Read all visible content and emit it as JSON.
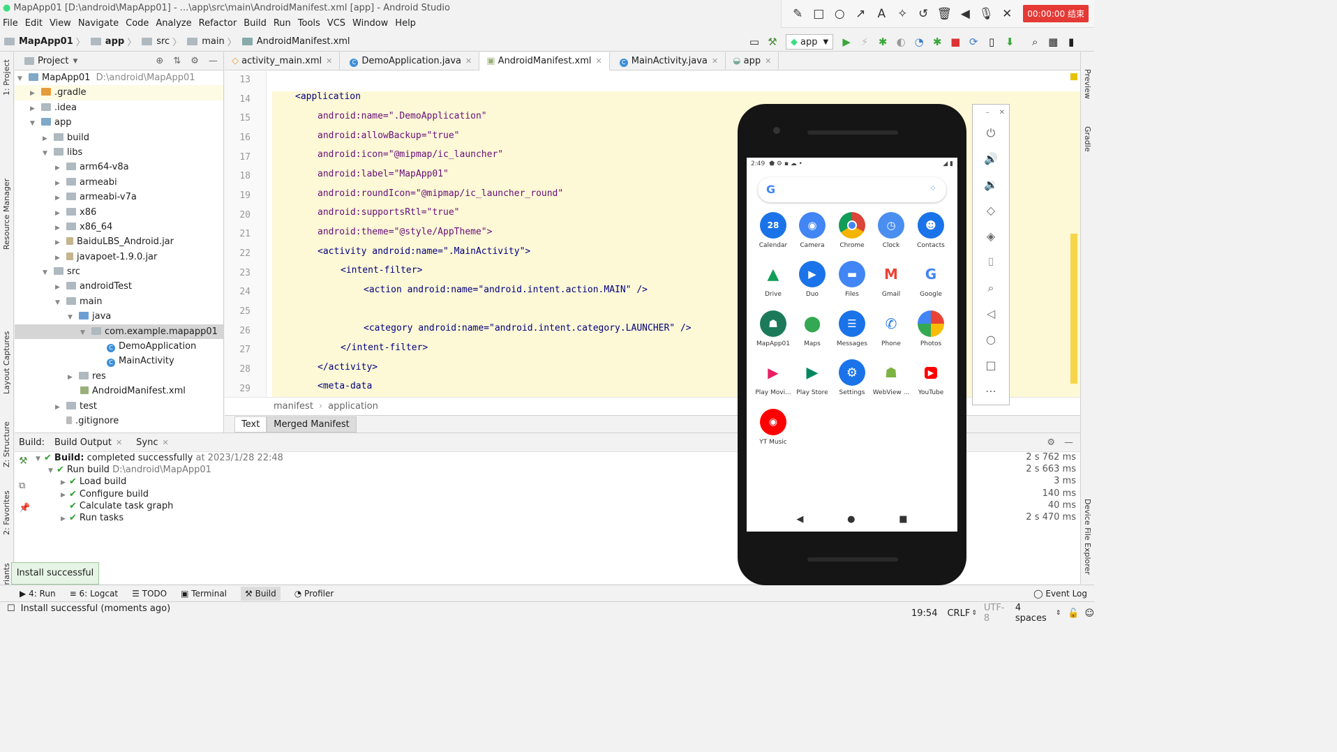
{
  "window": {
    "title": "MapApp01 [D:\\android\\MapApp01] - ...\\app\\src\\main\\AndroidManifest.xml [app] - Android Studio"
  },
  "menu": [
    "File",
    "Edit",
    "View",
    "Navigate",
    "Code",
    "Analyze",
    "Refactor",
    "Build",
    "Run",
    "Tools",
    "VCS",
    "Window",
    "Help"
  ],
  "recorder": {
    "timer": "00:00:00 结束"
  },
  "nav": {
    "project": "MapApp01",
    "module": "app",
    "src": "src",
    "main": "main",
    "file": "AndroidManifest.xml",
    "run_config": "app"
  },
  "project": {
    "header": "Project",
    "root_name": "MapApp01",
    "root_path": "D:\\android\\MapApp01",
    "items": [
      ".gradle",
      ".idea",
      "app",
      "build",
      "libs",
      "arm64-v8a",
      "armeabi",
      "armeabi-v7a",
      "x86",
      "x86_64",
      "BaiduLBS_Android.jar",
      "javapoet-1.9.0.jar",
      "src",
      "androidTest",
      "main",
      "java",
      "com.example.mapapp01",
      "DemoApplication",
      "MainActivity",
      "res",
      "AndroidManifest.xml",
      "test",
      ".gitignore"
    ]
  },
  "tabs": [
    "activity_main.xml",
    "DemoApplication.java",
    "AndroidManifest.xml",
    "MainActivity.java",
    "app"
  ],
  "code": {
    "lines": [
      {
        "n": "13",
        "text": ""
      },
      {
        "n": "14",
        "text": "<application"
      },
      {
        "n": "15",
        "text": "android:name=\".DemoApplication\""
      },
      {
        "n": "16",
        "text": "android:allowBackup=\"true\""
      },
      {
        "n": "17",
        "text": "android:icon=\"@mipmap/ic_launcher\""
      },
      {
        "n": "18",
        "text": "android:label=\"MapApp01\""
      },
      {
        "n": "19",
        "text": "android:roundIcon=\"@mipmap/ic_launcher_round\""
      },
      {
        "n": "20",
        "text": "android:supportsRtl=\"true\""
      },
      {
        "n": "21",
        "text": "android:theme=\"@style/AppTheme\">"
      },
      {
        "n": "22",
        "text": "<activity android:name=\".MainActivity\">"
      },
      {
        "n": "23",
        "text": "<intent-filter>"
      },
      {
        "n": "24",
        "text": "<action android:name=\"android.intent.action.MAIN\" />"
      },
      {
        "n": "25",
        "text": ""
      },
      {
        "n": "26",
        "text": "<category android:name=\"android.intent.category.LAUNCHER\" />"
      },
      {
        "n": "27",
        "text": "</intent-filter>"
      },
      {
        "n": "28",
        "text": "</activity>"
      },
      {
        "n": "29",
        "text": "<meta-data"
      }
    ]
  },
  "breadcrumb": {
    "a": "manifest",
    "b": "application"
  },
  "editor_tabs": {
    "text": "Text",
    "merged": "Merged Manifest"
  },
  "build": {
    "label": "Build:",
    "tab_output": "Build Output",
    "tab_sync": "Sync",
    "rows": [
      {
        "bold": "Build:",
        "text": "completed successfully",
        "extra": "at 2023/1/28 22:48",
        "time": "2 s 762 ms"
      },
      {
        "text": "Run build",
        "extra": "D:\\android\\MapApp01",
        "time": "2 s 663 ms"
      },
      {
        "text": "Load build",
        "time": "3 ms"
      },
      {
        "text": "Configure build",
        "time": "140 ms"
      },
      {
        "text": "Calculate task graph",
        "time": "40 ms"
      },
      {
        "text": "Run tasks",
        "time": "2 s 470 ms"
      }
    ]
  },
  "toast": "Install successful",
  "toolwindows": {
    "run": "4: Run",
    "logcat": "6: Logcat",
    "todo": "TODO",
    "terminal": "Terminal",
    "build": "Build",
    "profiler": "Profiler",
    "eventlog": "Event Log"
  },
  "status": {
    "message": "Install successful (moments ago)",
    "position": "19:54",
    "line_sep": "CRLF",
    "encoding": "UTF-8",
    "indent": "4 spaces"
  },
  "side": {
    "project": "1: Project",
    "resource": "Resource Manager",
    "layout": "Layout Captures",
    "structure": "Z: Structure",
    "favorites": "2: Favorites",
    "variants": "Build Variants",
    "preview": "Preview",
    "gradle": "Gradle",
    "device": "Device File Explorer"
  },
  "phone": {
    "time": "2:49",
    "calendar_day": "28",
    "apps": [
      {
        "label": "Calendar",
        "color": "#1a73e8"
      },
      {
        "label": "Camera",
        "color": "#4285f4"
      },
      {
        "label": "Chrome",
        "color": "#db4437"
      },
      {
        "label": "Clock",
        "color": "#4a8ef0"
      },
      {
        "label": "Contacts",
        "color": "#1a73e8"
      },
      {
        "label": "Drive",
        "color": "#0f9d58"
      },
      {
        "label": "Duo",
        "color": "#1a73e8"
      },
      {
        "label": "Files",
        "color": "#4285f4"
      },
      {
        "label": "Gmail",
        "color": "#ea4335"
      },
      {
        "label": "Google",
        "color": "#4285f4"
      },
      {
        "label": "MapApp01",
        "color": "#1b7a5a"
      },
      {
        "label": "Maps",
        "color": "#34a853"
      },
      {
        "label": "Messages",
        "color": "#1a73e8"
      },
      {
        "label": "Phone",
        "color": "#1a73e8"
      },
      {
        "label": "Photos",
        "color": "#fbbc05"
      },
      {
        "label": "Play Movi...",
        "color": "#e91e63"
      },
      {
        "label": "Play Store",
        "color": "#01875f"
      },
      {
        "label": "Settings",
        "color": "#1a73e8"
      },
      {
        "label": "WebView ...",
        "color": "#7cb342"
      },
      {
        "label": "YouTube",
        "color": "#ff0000"
      },
      {
        "label": "YT Music",
        "color": "#ff0000"
      }
    ]
  }
}
